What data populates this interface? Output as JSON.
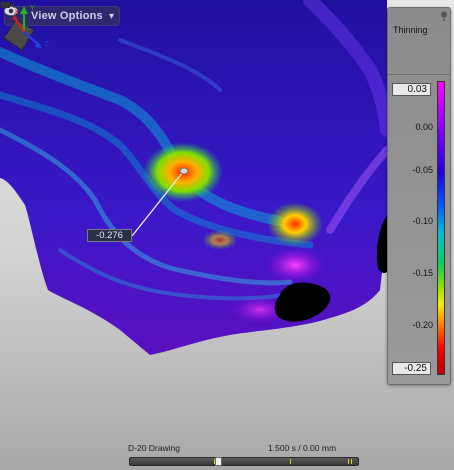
{
  "view_options": {
    "label": "View Options",
    "icon": "eye-icon",
    "chevron": "▾"
  },
  "legend": {
    "title": "Thinning",
    "max_value": "0.03",
    "min_value": "-0.25",
    "ticks": [
      "0.00",
      "-0.05",
      "-0.10",
      "-0.15",
      "-0.20"
    ],
    "colors": [
      "#ff00ff",
      "#9a00ff",
      "#1f00e6",
      "#0060ff",
      "#00bfd0",
      "#00d060",
      "#90e000",
      "#f5ef00",
      "#ff8000",
      "#ff0000"
    ]
  },
  "probe": {
    "value": "-0.276"
  },
  "status": {
    "operation": "D-20 Drawing",
    "time": "1.500 s / 0.00 mm"
  },
  "timeline": {
    "position": 0.38
  },
  "triad": {
    "x": "X",
    "y": "Y",
    "z": "Z"
  }
}
